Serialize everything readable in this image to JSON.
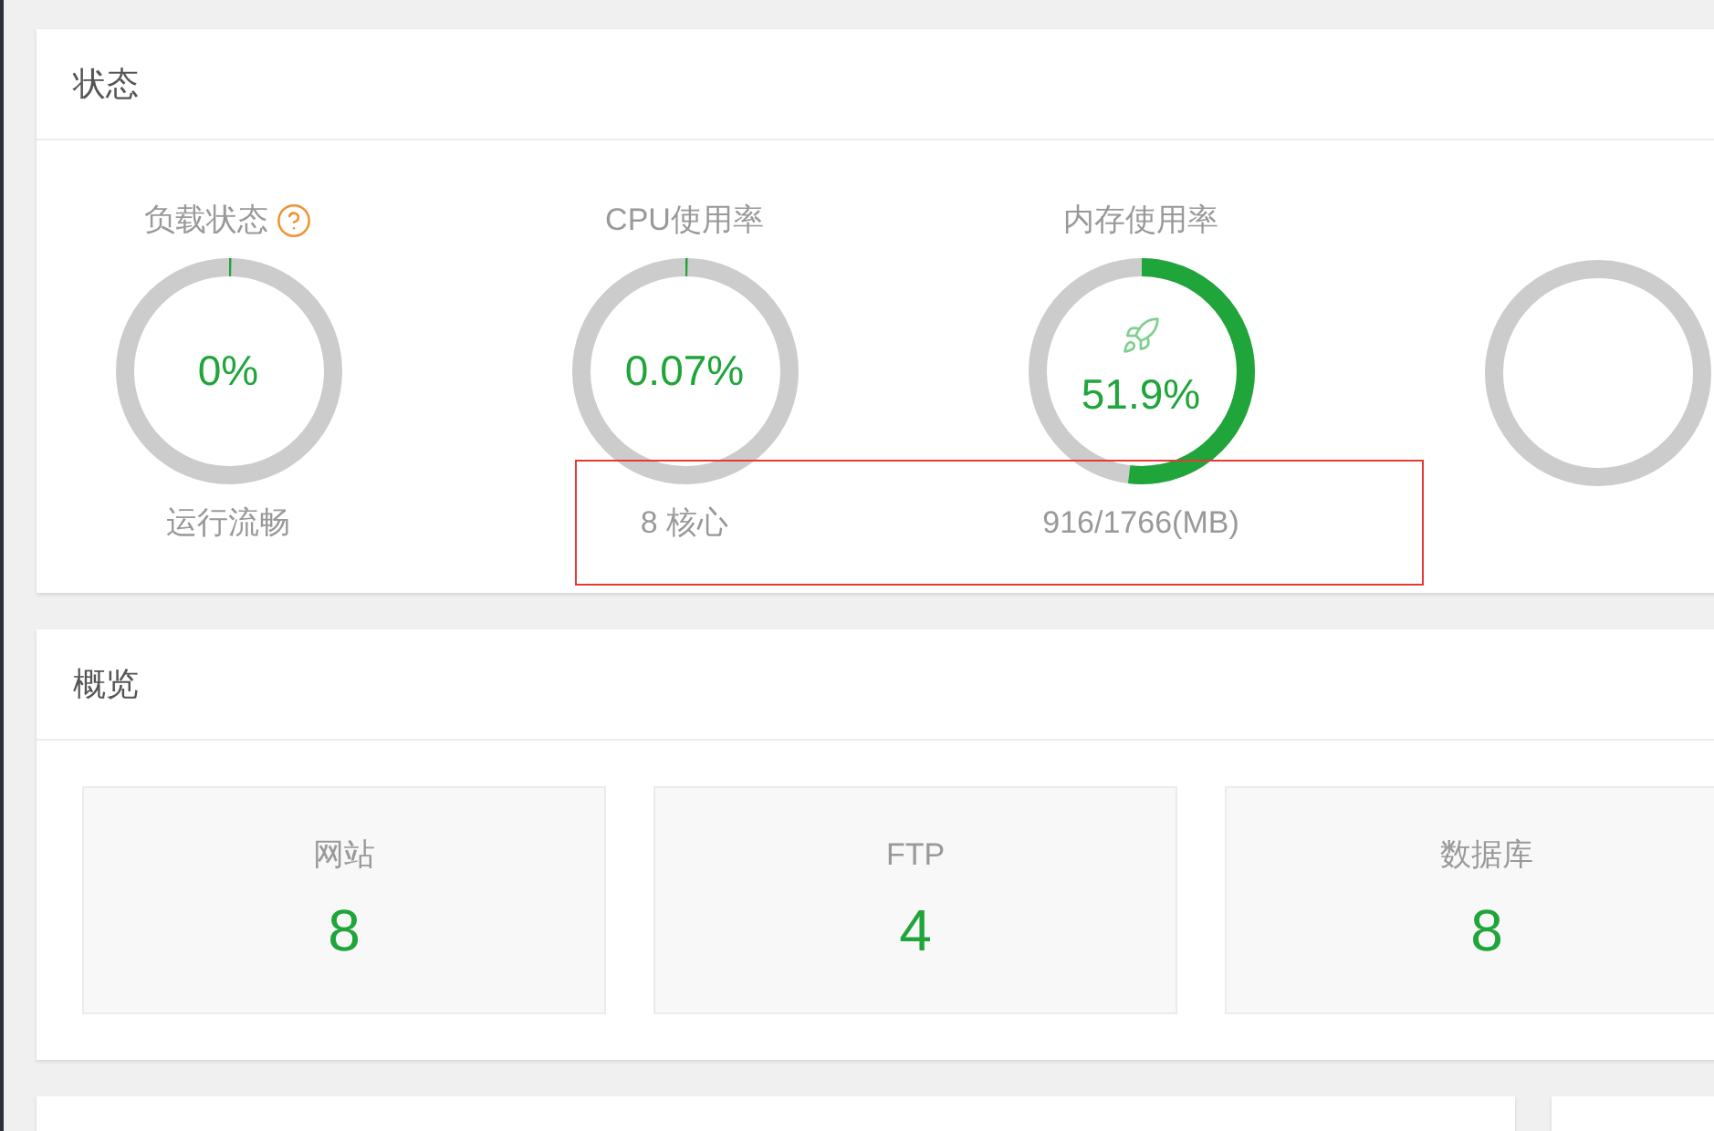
{
  "status_panel": {
    "title": "状态",
    "gauges": [
      {
        "label": "负载状态",
        "help": true,
        "value": "0%",
        "level": 0,
        "caption": "运行流畅",
        "show_icon": false
      },
      {
        "label": "CPU使用率",
        "help": false,
        "value": "0.07%",
        "level": 0.0007,
        "caption": "8 核心",
        "show_icon": false
      },
      {
        "label": "内存使用率",
        "help": false,
        "value": "51.9%",
        "level": 0.519,
        "caption": "916/1766(MB)",
        "show_icon": true
      }
    ]
  },
  "overview_panel": {
    "title": "概览",
    "cards": [
      {
        "label": "网站",
        "count": "8"
      },
      {
        "label": "FTP",
        "count": "4"
      },
      {
        "label": "数据库",
        "count": "8"
      }
    ]
  }
}
